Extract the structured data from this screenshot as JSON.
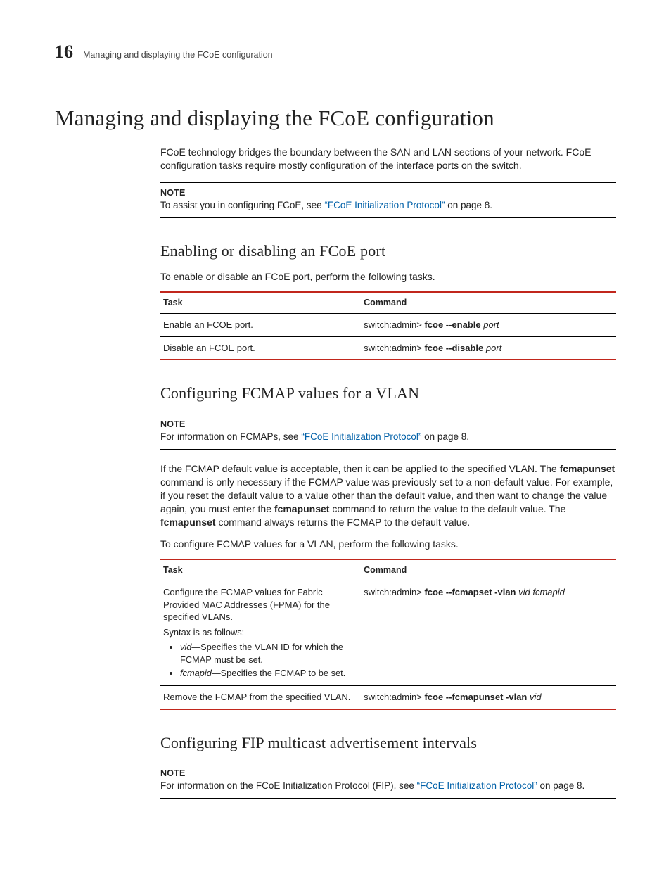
{
  "chapter_number": "16",
  "running_head": "Managing and displaying the FCoE configuration",
  "h1": "Managing and displaying the FCoE configuration",
  "intro": "FCoE technology bridges the boundary between the SAN and LAN sections of your network. FCoE configuration tasks require mostly configuration of the interface ports on the switch.",
  "note1": {
    "label": "NOTE",
    "pre": "To assist you in configuring FCoE, see ",
    "link": "“FCoE Initialization Protocol”",
    "post": " on page 8."
  },
  "sec1": {
    "title": "Enabling or disabling an FCoE port",
    "lead": "To enable or disable an FCoE port, perform the following tasks.",
    "th1": "Task",
    "th2": "Command",
    "row1": {
      "task": "Enable an FCOE port.",
      "pre": "switch:admin> ",
      "bold": "fcoe --enable ",
      "ital": "port"
    },
    "row2": {
      "task": "Disable an FCOE port.",
      "pre": "switch:admin> ",
      "bold": "fcoe --disable ",
      "ital": "port"
    }
  },
  "sec2": {
    "title": "Configuring FCMAP values for a VLAN",
    "note": {
      "label": "NOTE",
      "pre": "For information on FCMAPs, see ",
      "link": "“FCoE Initialization Protocol”",
      "post": " on page 8."
    },
    "para_a": "If the FCMAP default value is acceptable, then it can be applied to the specified VLAN. The ",
    "para_b": "fcmapunset",
    "para_c": " command is only necessary if the FCMAP value was previously set to a non-default value. For example, if you reset the default value to a value other than the default value, and then want to change the value again, you must enter the ",
    "para_d": "fcmapunset",
    "para_e": " command to return the value to the default value. The ",
    "para_f": "fcmapunset",
    "para_g": " command always returns the FCMAP to the default value.",
    "lead": "To configure FCMAP values for a VLAN, perform the following tasks.",
    "th1": "Task",
    "th2": "Command",
    "row1": {
      "task_a": "Configure the FCMAP values for Fabric Provided MAC Addresses (FPMA) for the specified VLANs.",
      "syntax_lead": "Syntax is as follows:",
      "li1_i": "vid",
      "li1_t": "—Specifies the VLAN ID for which the FCMAP must be set.",
      "li2_i": "fcmapid",
      "li2_t": "—Specifies the FCMAP to be set.",
      "pre": "switch:admin> ",
      "bold": "fcoe --fcmapset -vlan ",
      "ital": "vid fcmapid"
    },
    "row2": {
      "task": "Remove the FCMAP from the specified VLAN.",
      "pre": "switch:admin> ",
      "bold": "fcoe --fcmapunset -vlan ",
      "ital": "vid"
    }
  },
  "sec3": {
    "title": "Configuring FIP multicast advertisement intervals",
    "note": {
      "label": "NOTE",
      "pre": "For information on the FCoE Initialization Protocol (FIP), see ",
      "link": "“FCoE Initialization Protocol”",
      "post": " on page 8."
    }
  }
}
